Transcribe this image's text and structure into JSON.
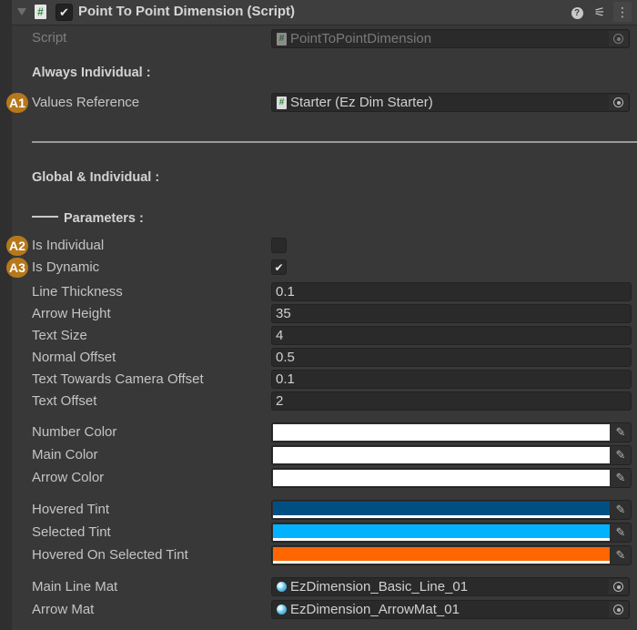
{
  "header": {
    "title": "Point To Point Dimension (Script)",
    "enabled": true,
    "icons": {
      "foldout": "triangle-down",
      "script": "#",
      "help": "?",
      "presets": "sliders",
      "menu": "⋮"
    }
  },
  "script_field": {
    "label": "Script",
    "value": "PointToPointDimension"
  },
  "sections": {
    "always_individual": "Always Individual :",
    "global_individual": "Global & Individual :",
    "parameters": "Parameters :"
  },
  "values_reference": {
    "badge": "A1",
    "label": "Values Reference",
    "value": "Starter (Ez Dim Starter)"
  },
  "toggles": [
    {
      "badge": "A2",
      "label": "Is Individual",
      "checked": false,
      "mark": ""
    },
    {
      "badge": "A3",
      "label": "Is Dynamic",
      "checked": true,
      "mark": "✔"
    }
  ],
  "numeric_fields": [
    {
      "label": "Line Thickness",
      "value": "0.1"
    },
    {
      "label": "Arrow Height",
      "value": "35"
    },
    {
      "label": "Text Size",
      "value": "4"
    },
    {
      "label": "Normal Offset",
      "value": "0.5"
    },
    {
      "label": "Text Towards Camera Offset",
      "value": "0.1"
    },
    {
      "label": "Text Offset",
      "value": "2"
    }
  ],
  "colors": [
    {
      "label": "Number Color",
      "color": "#ffffff"
    },
    {
      "label": "Main Color",
      "color": "#ffffff"
    },
    {
      "label": "Arrow Color",
      "color": "#ffffff"
    }
  ],
  "tints": [
    {
      "label": "Hovered Tint",
      "color": "#004f82"
    },
    {
      "label": "Selected Tint",
      "color": "#00b2ff"
    },
    {
      "label": "Hovered On Selected Tint",
      "color": "#ff6500"
    }
  ],
  "materials": [
    {
      "label": "Main Line Mat",
      "value": "EzDimension_Basic_Line_01"
    },
    {
      "label": "Arrow Mat",
      "value": "EzDimension_ArrowMat_01"
    }
  ],
  "eyedropper_glyph": "✎"
}
